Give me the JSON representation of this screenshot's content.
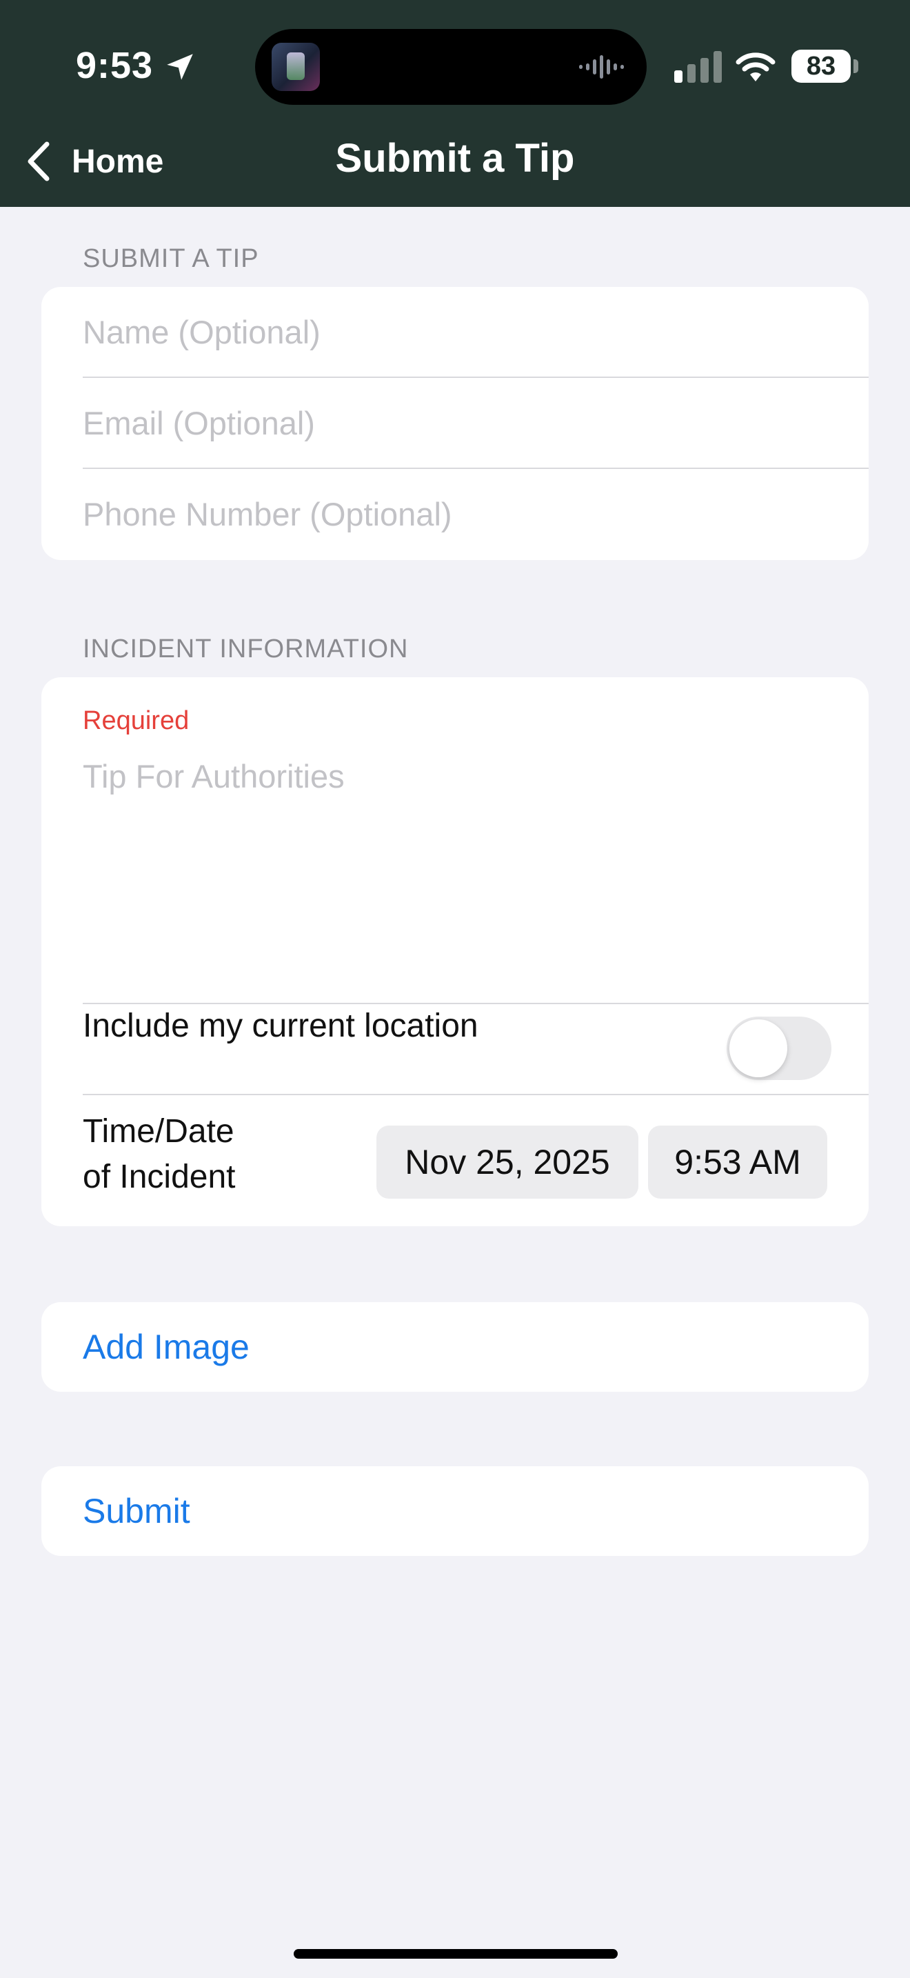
{
  "status_bar": {
    "time": "9:53",
    "battery": "83"
  },
  "nav": {
    "back_label": "Home",
    "title": "Submit a Tip"
  },
  "contact_section": {
    "header": "SUBMIT A TIP",
    "fields": [
      {
        "placeholder": "Name (Optional)"
      },
      {
        "placeholder": "Email (Optional)"
      },
      {
        "placeholder": "Phone Number (Optional)"
      }
    ]
  },
  "incident_section": {
    "header": "INCIDENT INFORMATION",
    "required_label": "Required",
    "tip_placeholder": "Tip For Authorities",
    "location_toggle_label": "Include my current location",
    "location_toggle_on": false,
    "time_label_line1": "Time/Date",
    "time_label_line2": "of Incident",
    "date_value": "Nov 25, 2025",
    "time_value": "9:53 AM"
  },
  "actions": {
    "add_image": "Add Image",
    "submit": "Submit"
  },
  "colors": {
    "header_bg": "#233530",
    "page_bg": "#f2f2f7",
    "link_blue": "#1a7ae8",
    "required_red": "#e5403a"
  }
}
